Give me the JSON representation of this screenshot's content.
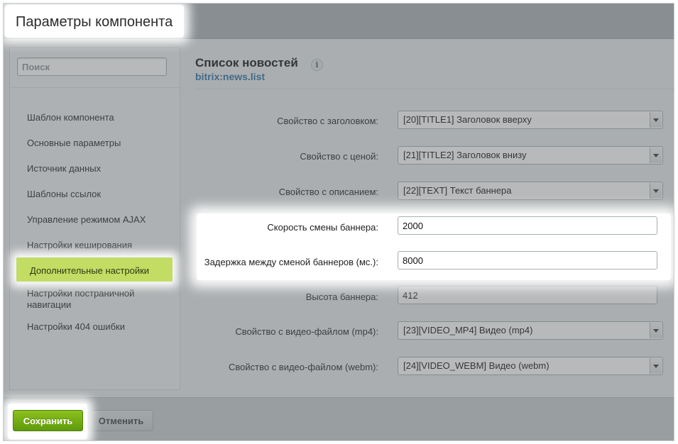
{
  "window": {
    "title": "Параметры компонента"
  },
  "sidebar": {
    "search_placeholder": "Поиск",
    "items": [
      {
        "label": "Шаблон компонента"
      },
      {
        "label": "Основные параметры"
      },
      {
        "label": "Источник данных"
      },
      {
        "label": "Шаблоны ссылок"
      },
      {
        "label": "Управление режимом AJAX"
      },
      {
        "label": "Настройки кеширования"
      },
      {
        "label": "Дополнительные настройки",
        "active": true
      },
      {
        "label": "Настройки постраничной навигации"
      },
      {
        "label": "Настройки 404 ошибки"
      }
    ]
  },
  "main": {
    "title": "Список новостей",
    "info_icon": "i",
    "subtitle": "bitrix:news.list",
    "fields": [
      {
        "label": "Свойство с заголовком:",
        "type": "select",
        "value": "[20][TITLE1] Заголовок вверху"
      },
      {
        "label": "Свойство с ценой:",
        "type": "select",
        "value": "[21][TITLE2] Заголовок внизу"
      },
      {
        "label": "Свойство с описанием:",
        "type": "select",
        "value": "[22][TEXT] Текст баннера"
      },
      {
        "label": "Скорость смены баннера:",
        "type": "input",
        "value": "2000"
      },
      {
        "label": "Задержка между сменой баннеров (мс.):",
        "type": "input",
        "value": "8000"
      },
      {
        "label": "Высота баннера:",
        "type": "input",
        "value": "412"
      },
      {
        "label": "Свойство с видео-файлом (mp4):",
        "type": "select",
        "value": "[23][VIDEO_MP4] Видео (mp4)"
      },
      {
        "label": "Свойство с видео-файлом (webm):",
        "type": "select",
        "value": "[24][VIDEO_WEBM] Видео (webm)"
      }
    ]
  },
  "footer": {
    "save_label": "Сохранить",
    "cancel_label": "Отменить"
  },
  "colors": {
    "accent_green": "#78b014",
    "link_blue": "#2a6fa4",
    "active_item": "#c2dc64"
  }
}
